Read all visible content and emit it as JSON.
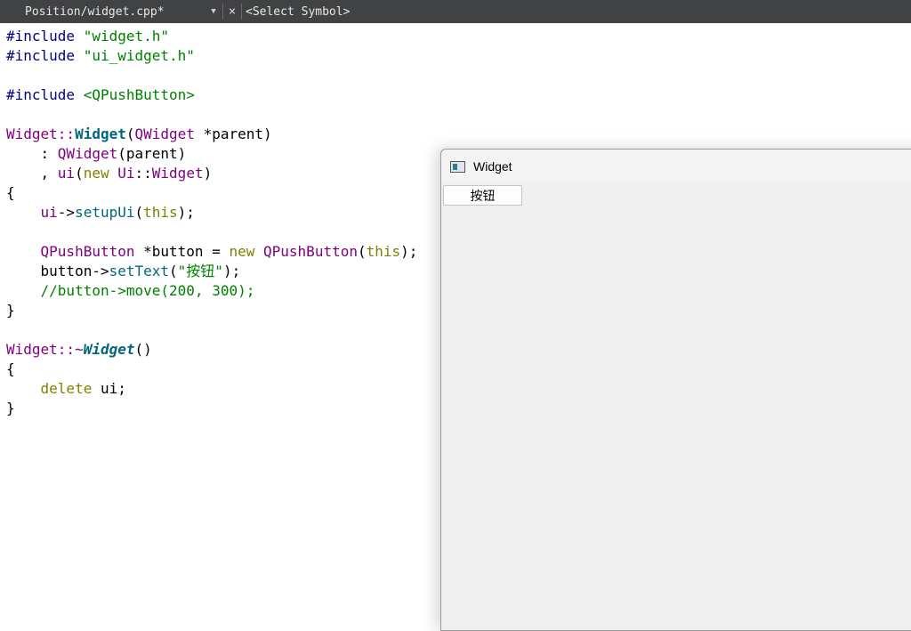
{
  "toolbar": {
    "file_tab": "Position/widget.cpp*",
    "close_glyph": "×",
    "symbol_selector": "<Select Symbol>"
  },
  "code": {
    "l1_dir": "#include",
    "l1_str": "\"widget.h\"",
    "l2_dir": "#include",
    "l2_str": "\"ui_widget.h\"",
    "l4_dir": "#include",
    "l4_str": "<QPushButton>",
    "l6_cls": "Widget",
    "l6_sep": "::",
    "l6_fn": "Widget",
    "l6_p1": "(",
    "l6_cls2": "QWidget",
    "l6_rest": " *parent)",
    "l7_pre": "    : ",
    "l7_cls": "QWidget",
    "l7_rest": "(parent)",
    "l8_pre": "    , ",
    "l8_ui": "ui",
    "l8_p": "(",
    "l8_new": "new",
    "l8_sp": " ",
    "l8_cls": "Ui",
    "l8_sep": "::",
    "l8_cls2": "Widget",
    "l8_end": ")",
    "l9": "{",
    "l10_pre": "    ",
    "l10_ui": "ui",
    "l10_arrow": "->",
    "l10_fn": "setupUi",
    "l10_p": "(",
    "l10_kw": "this",
    "l10_end": ");",
    "l12_pre": "    ",
    "l12_cls": "QPushButton",
    "l12_mid": " *button = ",
    "l12_new": "new",
    "l12_sp": " ",
    "l12_cls2": "QPushButton",
    "l12_p": "(",
    "l12_kw": "this",
    "l12_end": ");",
    "l13_pre": "    button->",
    "l13_fn": "setText",
    "l13_p": "(",
    "l13_str": "\"按钮\"",
    "l13_end": ");",
    "l14_pre": "    ",
    "l14_cm": "//button->move(200, 300);",
    "l15": "}",
    "l17_cls": "Widget",
    "l17_sep": "::~",
    "l17_fn": "Widget",
    "l17_end": "()",
    "l18": "{",
    "l19_pre": "    ",
    "l19_kw": "delete",
    "l19_rest": " ui;",
    "l20": "}"
  },
  "window": {
    "title": "Widget",
    "button_label": "按钮"
  }
}
